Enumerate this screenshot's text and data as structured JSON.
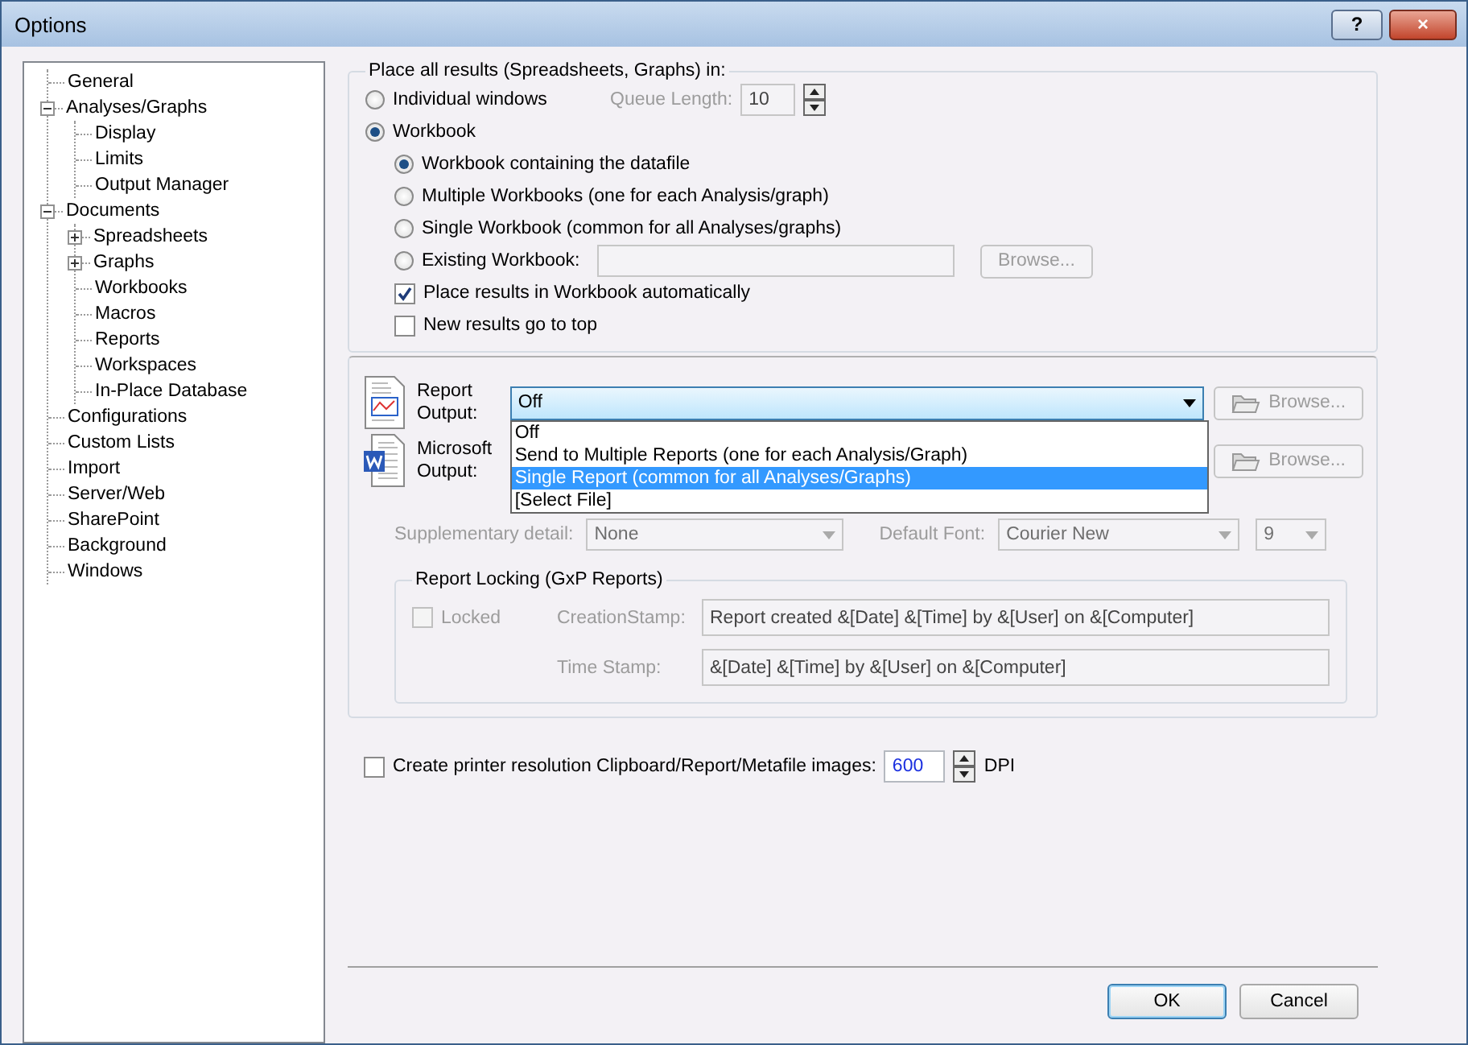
{
  "window": {
    "title": "Options",
    "help_button": "?",
    "close_button": "×"
  },
  "tree": [
    {
      "label": "General",
      "kind": "leaf"
    },
    {
      "label": "Analyses/Graphs",
      "kind": "folder",
      "expanded": true,
      "children": [
        {
          "label": "Display",
          "kind": "leaf"
        },
        {
          "label": "Limits",
          "kind": "leaf"
        },
        {
          "label": "Output Manager",
          "kind": "leaf"
        }
      ]
    },
    {
      "label": "Documents",
      "kind": "folder",
      "expanded": true,
      "children": [
        {
          "label": "Spreadsheets",
          "kind": "folder",
          "expanded": false
        },
        {
          "label": "Graphs",
          "kind": "folder",
          "expanded": false
        },
        {
          "label": "Workbooks",
          "kind": "leaf"
        },
        {
          "label": "Macros",
          "kind": "leaf"
        },
        {
          "label": "Reports",
          "kind": "leaf"
        },
        {
          "label": "Workspaces",
          "kind": "leaf"
        },
        {
          "label": "In-Place Database",
          "kind": "leaf"
        }
      ]
    },
    {
      "label": "Configurations",
      "kind": "leaf"
    },
    {
      "label": "Custom Lists",
      "kind": "leaf"
    },
    {
      "label": "Import",
      "kind": "leaf"
    },
    {
      "label": "Server/Web",
      "kind": "leaf"
    },
    {
      "label": "SharePoint",
      "kind": "leaf"
    },
    {
      "label": "Background",
      "kind": "leaf"
    },
    {
      "label": "Windows",
      "kind": "leaf"
    }
  ],
  "placement": {
    "title": "Place all results (Spreadsheets, Graphs) in:",
    "options": [
      {
        "label": "Individual windows",
        "selected": false
      },
      {
        "label": "Workbook",
        "selected": true
      }
    ],
    "queue_length": {
      "label": "Queue Length:",
      "value": "10",
      "disabled": true
    },
    "suboptions": [
      {
        "label": "Workbook containing the datafile",
        "selected": true,
        "kind": "plain"
      },
      {
        "label": "Multiple Workbooks (one for each Analysis/graph)",
        "selected": false,
        "kind": "plain"
      },
      {
        "label": "Single Workbook (common for all Analyses/graphs)",
        "selected": false,
        "kind": "plain"
      },
      {
        "label": "Existing Workbook:",
        "selected": false,
        "kind": "field",
        "browse": "Browse...",
        "disabled": true
      }
    ],
    "checks": [
      {
        "label": "Place results in Workbook automatically",
        "checked": true
      },
      {
        "label": "New results go to top",
        "checked": false
      }
    ]
  },
  "report_output": {
    "label": "Report Output:",
    "value": "Off",
    "browse": "Browse...",
    "browse_disabled": true,
    "dropdown": [
      {
        "label": "Off",
        "highlighted": false
      },
      {
        "label": "Send to Multiple Reports (one for each Analysis/Graph)",
        "highlighted": false
      },
      {
        "label": "Single Report (common for all Analyses/Graphs)",
        "highlighted": true
      },
      {
        "label": "[Select File]",
        "highlighted": false
      }
    ]
  },
  "word_output": {
    "label": "Microsoft Output:",
    "browse": "Browse...",
    "browse_disabled": true
  },
  "supplementary": {
    "label": "Supplementary detail:",
    "value": "None",
    "disabled": true
  },
  "default_font": {
    "label": "Default Font:",
    "value": "Courier New",
    "size": "9",
    "disabled": true
  },
  "locking": {
    "title": "Report Locking (GxP Reports)",
    "locked": {
      "label": "Locked",
      "checked": false
    },
    "creation_stamp": {
      "label": "CreationStamp:",
      "value": "Report created &[Date] &[Time] by &[User] on &[Computer]"
    },
    "time_stamp": {
      "label": "Time Stamp:",
      "value": "&[Date] &[Time] by &[User] on &[Computer]"
    },
    "disabled": true
  },
  "dpi": {
    "label": "Create printer resolution Clipboard/Report/Metafile images:",
    "checked": false,
    "value": "600",
    "unit": "DPI"
  },
  "buttons": [
    {
      "label": "OK",
      "kind": "default"
    },
    {
      "label": "Cancel",
      "kind": "normal"
    }
  ]
}
